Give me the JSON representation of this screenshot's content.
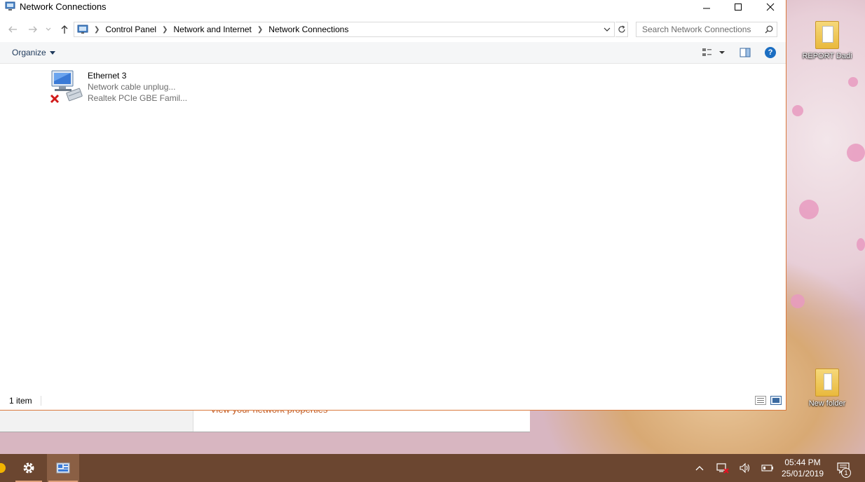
{
  "window": {
    "title": "Network Connections",
    "controls": {
      "minimize": "minimize",
      "maximize": "maximize",
      "close": "close"
    }
  },
  "address": {
    "breadcrumbs": [
      "Control Panel",
      "Network and Internet",
      "Network Connections"
    ]
  },
  "search": {
    "placeholder": "Search Network Connections"
  },
  "toolbar": {
    "organize_label": "Organize"
  },
  "connections": [
    {
      "name": "Ethernet 3",
      "status": "Network cable unplug...",
      "device": "Realtek PCIe GBE Famil..."
    }
  ],
  "statusbar": {
    "item_count": "1 item"
  },
  "background_window": {
    "link_text": "View your network properties"
  },
  "desktop": {
    "icons": [
      {
        "label": "REPORT Dadi"
      },
      {
        "label": "New folder"
      }
    ]
  },
  "taskbar": {
    "time": "05:44 PM",
    "date": "25/01/2019",
    "notification_count": "1"
  },
  "colors": {
    "accent_border": "#d9783c",
    "link": "#c15a21",
    "taskbar": "#6b4630",
    "help_icon": "#1b6ec2"
  }
}
